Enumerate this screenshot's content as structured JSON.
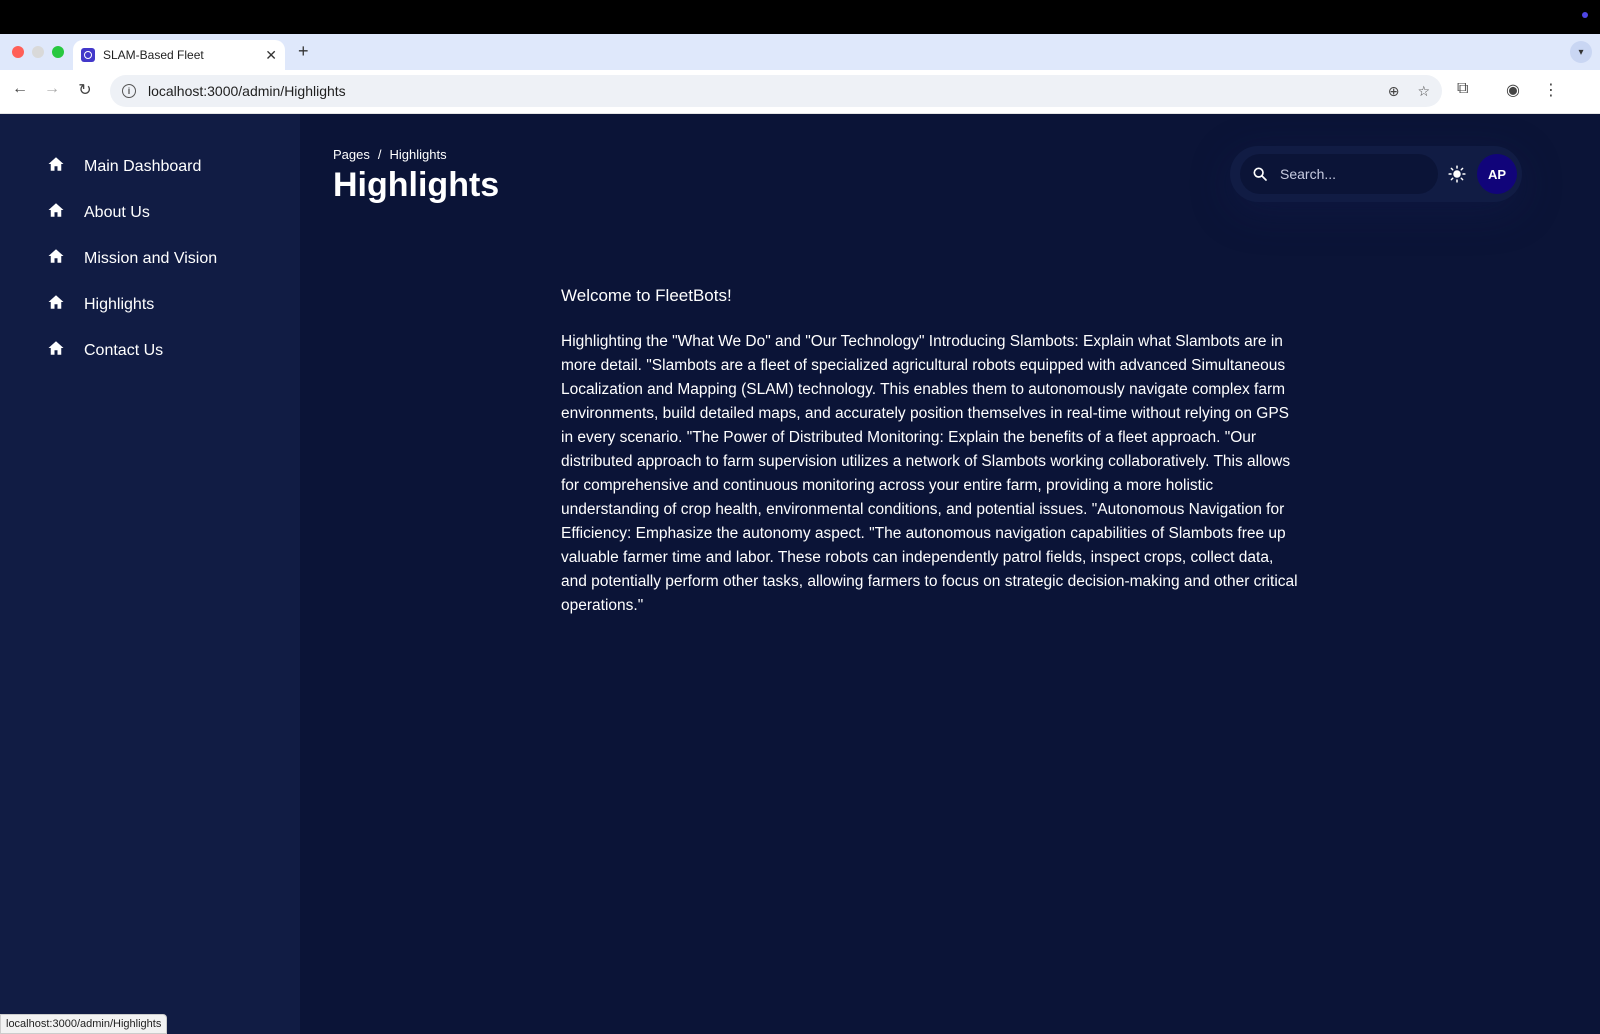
{
  "browser": {
    "tab_title": "SLAM-Based Fleet",
    "tab_close": "✕",
    "new_tab": "+",
    "url": "localhost:3000/admin/Highlights",
    "status_url": "localhost:3000/admin/Highlights"
  },
  "sidebar": {
    "items": [
      {
        "label": "Main Dashboard",
        "icon": "home-icon"
      },
      {
        "label": "About Us",
        "icon": "home-icon"
      },
      {
        "label": "Mission and Vision",
        "icon": "home-icon"
      },
      {
        "label": "Highlights",
        "icon": "home-icon"
      },
      {
        "label": "Contact Us",
        "icon": "home-icon"
      }
    ]
  },
  "breadcrumb": {
    "root": "Pages",
    "separator": "/",
    "current": "Highlights"
  },
  "page": {
    "title": "Highlights"
  },
  "header": {
    "search_placeholder": "Search...",
    "avatar_initials": "AP"
  },
  "content": {
    "welcome": "Welcome to FleetBots!",
    "body": "Highlighting the \"What We Do\" and \"Our Technology\" Introducing Slambots: Explain what Slambots are in more detail. \"Slambots are a fleet of specialized agricultural robots equipped with advanced Simultaneous Localization and Mapping (SLAM) technology. This enables them to autonomously navigate complex farm environments, build detailed maps, and accurately position themselves in real-time without relying on GPS in every scenario. \"The Power of Distributed Monitoring: Explain the benefits of a fleet approach. \"Our distributed approach to farm supervision utilizes a network of Slambots working collaboratively. This allows for comprehensive and continuous monitoring across your entire farm, providing a more holistic understanding of crop health, environmental conditions, and potential issues. \"Autonomous Navigation for Efficiency: Emphasize the autonomy aspect. \"The autonomous navigation capabilities of Slambots free up valuable farmer time and labor. These robots can independently patrol fields, inspect crops, collect data, and potentially perform other tasks, allowing farmers to focus on strategic decision-making and other critical operations.\""
  },
  "colors": {
    "app_bg": "#0b1437",
    "sidebar_bg": "#111c44",
    "avatar_bg": "#11047a"
  }
}
